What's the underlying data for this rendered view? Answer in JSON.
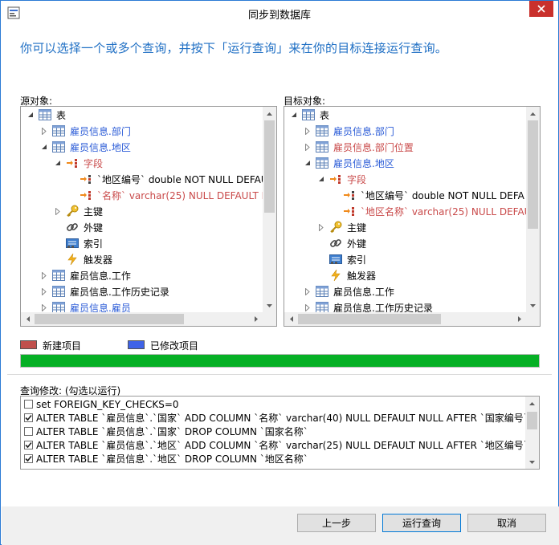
{
  "window": {
    "title": "同步到数据库"
  },
  "heading": "你可以选择一个或多个查询，并按下「运行查询」来在你的目标连接运行查询。",
  "source": {
    "label": "源对象:",
    "rows": [
      {
        "text": "表",
        "color": "black",
        "icon": "table-icon",
        "exp": "open"
      },
      {
        "text": "雇员信息.部门",
        "color": "blue",
        "icon": "table-icon",
        "exp": "closed"
      },
      {
        "text": "雇员信息.地区",
        "color": "blue",
        "icon": "table-icon",
        "exp": "open"
      },
      {
        "text": "字段",
        "color": "red",
        "icon": "fields-icon",
        "exp": "open"
      },
      {
        "text": "`地区编号` double NOT NULL DEFAU",
        "color": "black",
        "icon": "field-icon",
        "exp": "none"
      },
      {
        "text": "`名称` varchar(25) NULL DEFAULT N",
        "color": "red",
        "icon": "field-red-icon",
        "exp": "none"
      },
      {
        "text": "主键",
        "color": "black",
        "icon": "key-icon",
        "exp": "closed"
      },
      {
        "text": "外键",
        "color": "black",
        "icon": "link-icon",
        "exp": "none"
      },
      {
        "text": "索引",
        "color": "black",
        "icon": "index-icon",
        "exp": "none"
      },
      {
        "text": "触发器",
        "color": "black",
        "icon": "trigger-icon",
        "exp": "none"
      },
      {
        "text": "雇员信息.工作",
        "color": "black",
        "icon": "table-icon",
        "exp": "closed"
      },
      {
        "text": "雇员信息.工作历史记录",
        "color": "black",
        "icon": "table-icon",
        "exp": "closed"
      },
      {
        "text": "雇员信息.雇员",
        "color": "blue",
        "icon": "table-icon",
        "exp": "closed"
      }
    ]
  },
  "target": {
    "label": "目标对象:",
    "rows": [
      {
        "text": "表",
        "color": "black",
        "icon": "table-icon",
        "exp": "open"
      },
      {
        "text": "雇员信息.部门",
        "color": "blue",
        "icon": "table-icon",
        "exp": "closed"
      },
      {
        "text": "雇员信息.部门位置",
        "color": "red",
        "icon": "table-icon",
        "exp": "closed"
      },
      {
        "text": "雇员信息.地区",
        "color": "blue",
        "icon": "table-icon",
        "exp": "open"
      },
      {
        "text": "字段",
        "color": "red",
        "icon": "fields-icon",
        "exp": "open"
      },
      {
        "text": "`地区编号` double NOT NULL DEFA",
        "color": "black",
        "icon": "field-icon",
        "exp": "none"
      },
      {
        "text": "`地区名称` varchar(25) NULL DEFAU",
        "color": "red",
        "icon": "field-red-icon",
        "exp": "none"
      },
      {
        "text": "主键",
        "color": "black",
        "icon": "key-icon",
        "exp": "closed"
      },
      {
        "text": "外键",
        "color": "black",
        "icon": "link-icon",
        "exp": "none"
      },
      {
        "text": "索引",
        "color": "black",
        "icon": "index-icon",
        "exp": "none"
      },
      {
        "text": "触发器",
        "color": "black",
        "icon": "trigger-icon",
        "exp": "none"
      },
      {
        "text": "雇员信息.工作",
        "color": "black",
        "icon": "table-icon",
        "exp": "closed"
      },
      {
        "text": "雇员信息.工作历史记录",
        "color": "black",
        "icon": "table-icon",
        "exp": "closed"
      }
    ]
  },
  "legend": {
    "new_label": "新建项目",
    "modified_label": "已修改项目",
    "new_color": "#c0504d",
    "modified_color": "#3f63e8"
  },
  "progress": {
    "fraction": 1.0,
    "color": "#06b025"
  },
  "queries": {
    "label": "查询修改: (勾选以运行)",
    "items": [
      {
        "text": "set FOREIGN_KEY_CHECKS=0",
        "checked": false
      },
      {
        "text": "ALTER TABLE `雇员信息`.`国家` ADD COLUMN `名称` varchar(40) NULL DEFAULT NULL AFTER `国家编号`",
        "checked": true
      },
      {
        "text": "ALTER TABLE `雇员信息`.`国家` DROP COLUMN `国家名称`",
        "checked": false
      },
      {
        "text": "ALTER TABLE `雇员信息`.`地区` ADD COLUMN `名称` varchar(25) NULL DEFAULT NULL AFTER `地区编号`",
        "checked": true
      },
      {
        "text": "ALTER TABLE `雇员信息`.`地区` DROP COLUMN `地区名称`",
        "checked": true
      }
    ]
  },
  "buttons": {
    "back": "上一步",
    "run": "运行查询",
    "cancel": "取消"
  }
}
